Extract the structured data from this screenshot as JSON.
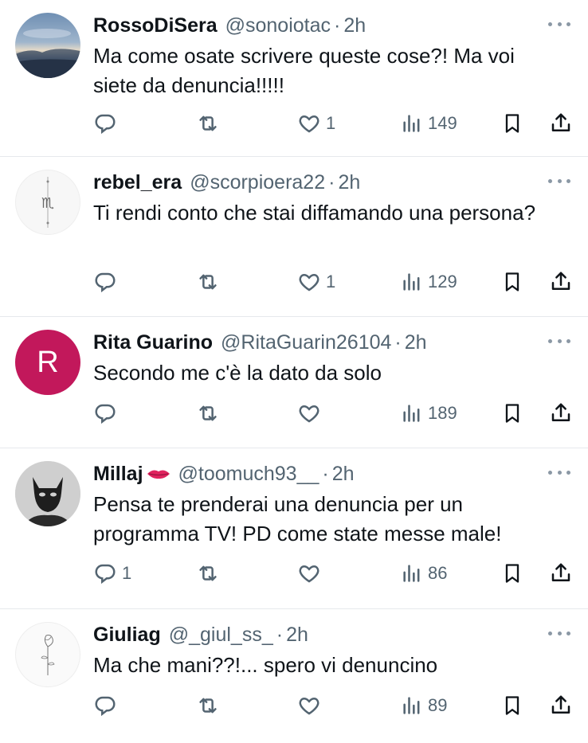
{
  "tweets": [
    {
      "name": "RossoDiSera",
      "handle": "@sonoiotac",
      "sep": "·",
      "time": "2h",
      "text": "Ma come osate scrivere queste cose?! Ma voi siete da denuncia!!!!!",
      "replies": "",
      "retweets": "",
      "likes": "1",
      "views": "149",
      "avatar": "landscape-photo"
    },
    {
      "name": "rebel_era",
      "handle": "@scorpioera22",
      "sep": "·",
      "time": "2h",
      "text": "Ti rendi conto che stai diffamando una persona?",
      "replies": "",
      "retweets": "",
      "likes": "1",
      "views": "129",
      "avatar": "scorpio-symbol"
    },
    {
      "name": "Rita Guarino",
      "handle": "@RitaGuarin26104",
      "sep": "·",
      "time": "2h",
      "text": "Secondo me c'è la dato da solo",
      "replies": "",
      "retweets": "",
      "likes": "",
      "views": "189",
      "avatar_letter": "R",
      "avatar_color": "#c2185b"
    },
    {
      "name": "Millaj",
      "handle": "@toomuch93__",
      "sep": "·",
      "time": "2h",
      "text": "Pensa te prenderai una denuncia per un programma TV! PD come state messe male!",
      "replies": "1",
      "retweets": "",
      "likes": "",
      "views": "86",
      "avatar": "masked-portrait"
    },
    {
      "name": "Giuliag",
      "handle": "@_giul_ss_",
      "sep": "·",
      "time": "2h",
      "text": "Ma che mani??!... spero vi denuncino",
      "replies": "",
      "retweets": "",
      "likes": "",
      "views": "89",
      "avatar": "rose-drawing"
    }
  ],
  "colors": {
    "text": "#0f1419",
    "secondary": "#536471",
    "divider": "#e6e9ec"
  }
}
